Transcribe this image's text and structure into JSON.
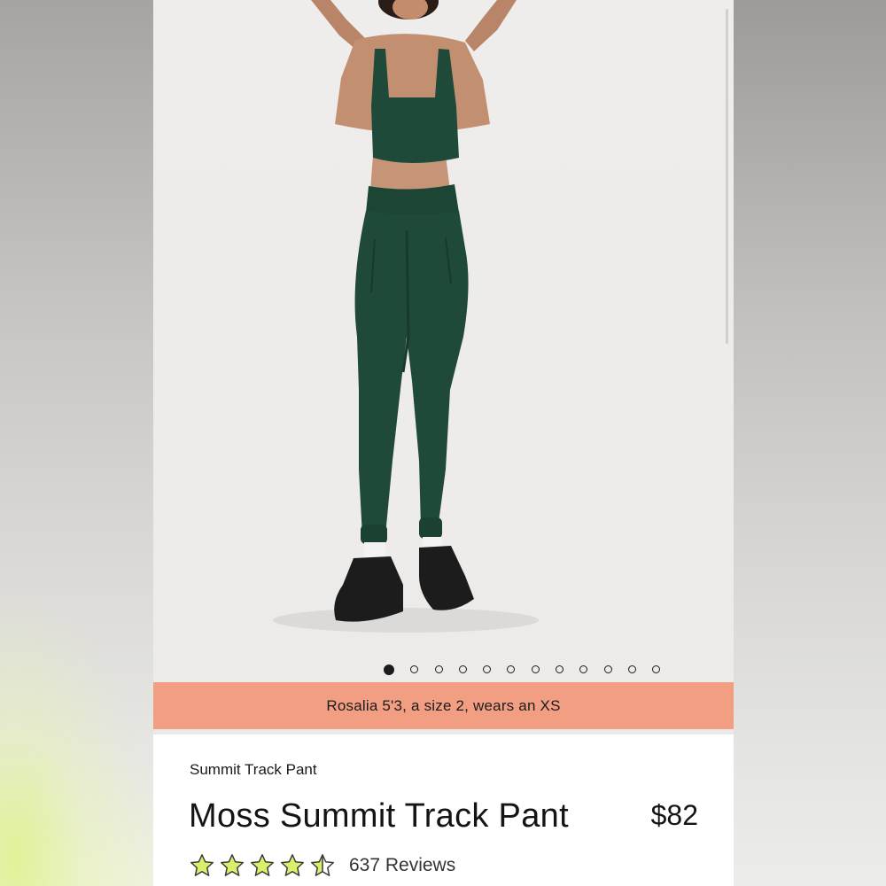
{
  "carousel": {
    "total_images": 12,
    "active_index": 0
  },
  "banner": {
    "model_info": "Rosalia 5'3, a size 2, wears an XS",
    "color": "#f19e82"
  },
  "product": {
    "subtitle": "Summit Track Pant",
    "title": "Moss Summit Track Pant",
    "price": "$82",
    "rating": 4.5,
    "rating_max": 5,
    "reviews": "637 Reviews",
    "product_color": "#1f4a3a",
    "star_color": "#d8f06a"
  },
  "icons": [
    "star-icon",
    "half-star-icon",
    "carousel-dot-icon"
  ]
}
